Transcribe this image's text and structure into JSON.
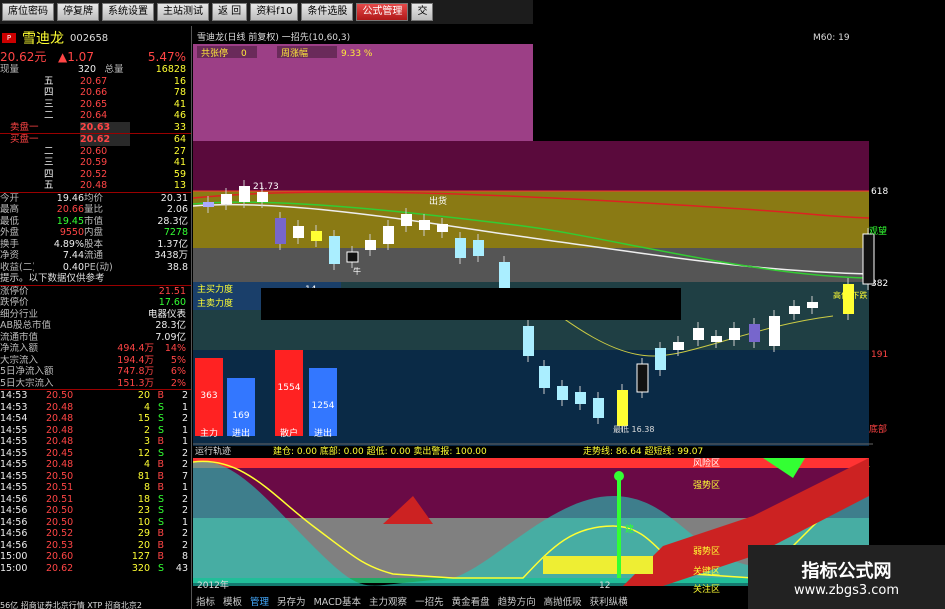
{
  "toolbar": {
    "buttons": [
      "席位密码",
      "停复牌",
      "系统设置",
      "主站测试",
      "返 回",
      "资料f10",
      "条件选股",
      "公式管理",
      "交"
    ],
    "active_index": 7
  },
  "stock": {
    "name": "雪迪龙",
    "code": "002658",
    "price": "20.62元",
    "change": "▲1.07",
    "pct": "5.47%",
    "now_label": "现量",
    "now": "320",
    "total_label": "总量",
    "total": "16828"
  },
  "asks": [
    [
      "五",
      "20.67",
      "16"
    ],
    [
      "四",
      "20.66",
      "78"
    ],
    [
      "三",
      "20.65",
      "41"
    ],
    [
      "二",
      "20.64",
      "46"
    ],
    [
      "卖盘一",
      "20.63",
      "33"
    ]
  ],
  "bids": [
    [
      "买盘一",
      "20.62",
      "64"
    ],
    [
      "二",
      "20.60",
      "27"
    ],
    [
      "三",
      "20.59",
      "41"
    ],
    [
      "四",
      "20.52",
      "59"
    ],
    [
      "五",
      "20.48",
      "13"
    ]
  ],
  "stats": [
    [
      "今开",
      "19.46",
      "均价",
      "20.31"
    ],
    [
      "最高",
      "20.66",
      "量比",
      "2.06"
    ],
    [
      "最低",
      "19.45",
      "市值",
      "28.3亿"
    ],
    [
      "外盘",
      "9550",
      "内盘",
      "7278"
    ],
    [
      "换手",
      "4.89%",
      "股本",
      "1.37亿"
    ],
    [
      "净资",
      "7.44",
      "流通",
      "3438万"
    ],
    [
      "收益(二)",
      "0.40",
      "PE(动)",
      "38.8"
    ]
  ],
  "tip": "提示。以下数据仅供参考",
  "info": [
    [
      "涨停价",
      "21.51"
    ],
    [
      "跌停价",
      "17.60"
    ],
    [
      "细分行业",
      "电器仪表"
    ],
    [
      "AB股总市值",
      "28.3亿"
    ],
    [
      "流通市值",
      "7.09亿"
    ],
    [
      "净流入额",
      "494.4万",
      "14%"
    ],
    [
      "大宗流入",
      "194.4万",
      "5%"
    ],
    [
      "5日净流入额",
      "747.8万",
      "6%"
    ],
    [
      "5日大宗流入",
      "151.3万",
      "2%"
    ]
  ],
  "ticks": [
    [
      "14:53",
      "20.50",
      "20",
      "B",
      "2"
    ],
    [
      "14:53",
      "20.48",
      "4",
      "S",
      "1"
    ],
    [
      "14:54",
      "20.48",
      "15",
      "S",
      "2"
    ],
    [
      "14:55",
      "20.48",
      "2",
      "S",
      "1"
    ],
    [
      "14:55",
      "20.48",
      "3",
      "B",
      "1"
    ],
    [
      "14:55",
      "20.45",
      "12",
      "S",
      "2"
    ],
    [
      "14:55",
      "20.48",
      "4",
      "B",
      "2"
    ],
    [
      "14:55",
      "20.50",
      "81",
      "B",
      "7"
    ],
    [
      "14:55",
      "20.51",
      "8",
      "B",
      "1"
    ],
    [
      "14:56",
      "20.51",
      "18",
      "S",
      "2"
    ],
    [
      "14:56",
      "20.50",
      "23",
      "S",
      "2"
    ],
    [
      "14:56",
      "20.50",
      "10",
      "S",
      "1"
    ],
    [
      "14:56",
      "20.52",
      "29",
      "B",
      "2"
    ],
    [
      "14:56",
      "20.53",
      "20",
      "B",
      "2"
    ],
    [
      "15:00",
      "20.60",
      "127",
      "B",
      "8"
    ],
    [
      "15:00",
      "20.62",
      "320",
      "S",
      "43"
    ]
  ],
  "status": "56亿 招商证券北京行情 XTP 招商北京2",
  "chart": {
    "title": "雪迪龙(日线 前复权)  一招先(10,60,3)",
    "m60": "M60: 19",
    "tag1": "共张停",
    "tag1v": "0",
    "tag2": "周涨幅",
    "tag2v": "9.33  %",
    "price_hi": "21.73",
    "lbl_618": "618",
    "lbl_382": "382",
    "lbl_191": "191",
    "label_chuhuo": "出货",
    "label_guanwang": "观望",
    "label_gaowei": "高位 下跌",
    "label_dibu": "底部",
    "label_niu": "牛",
    "label_low": "最低 16.38",
    "force1": "主买力度",
    "force1v": "14",
    "force2": "主卖力度",
    "bars": [
      {
        "label": "主力",
        "v": "363"
      },
      {
        "label": "进出",
        "v": "169"
      },
      {
        "label": "散户",
        "v": "1554"
      },
      {
        "label": "进出",
        "v": "1254"
      }
    ],
    "osc_title": "运行轨迹",
    "osc_vals": "建仓: 0.00  底部: 0.00  超低: 0.00  卖出警报: 100.00",
    "osc_vals2": "走势线: 86.64  超短线: 99.07",
    "zones": [
      "风险区",
      "强势区",
      "弱势区",
      "关键区",
      "关注区"
    ],
    "zone_jian": "建",
    "xlabels": [
      "2012年",
      "12"
    ]
  },
  "tabs": [
    "指标",
    "模板",
    "管理",
    "另存为",
    "MACD基本",
    "主力观察",
    "一招先",
    "黄金看盘",
    "趋势方向",
    "高抛低吸",
    "获利纵横"
  ],
  "tab_active": 2,
  "watermark": {
    "line1": "指标公式网",
    "line2": "www.zbgs3.com"
  }
}
